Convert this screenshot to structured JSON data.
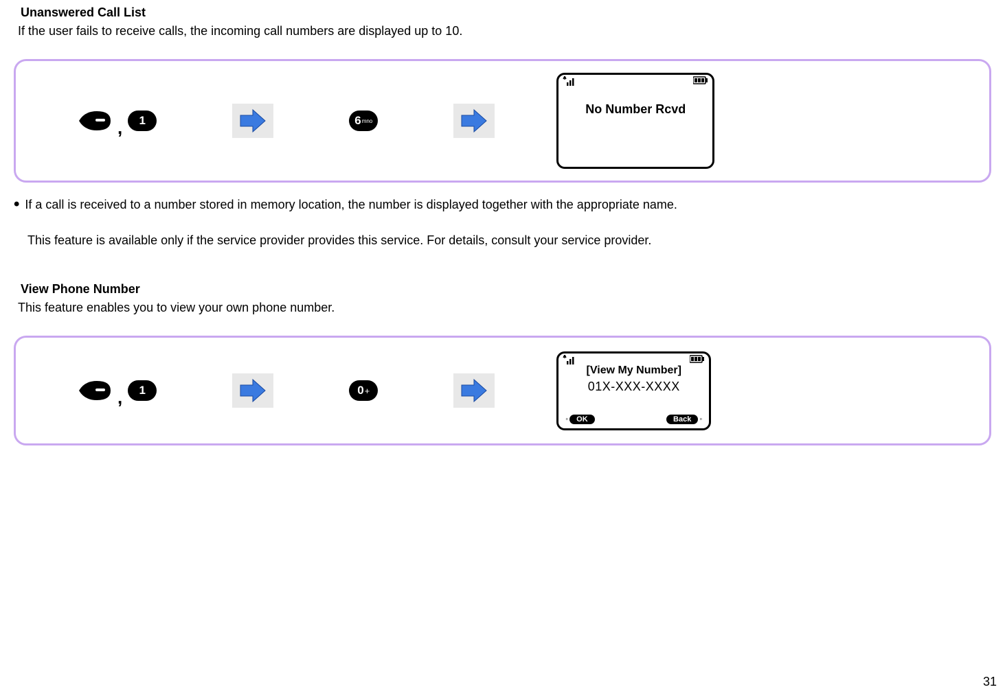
{
  "section1": {
    "heading": "Unanswered Call List",
    "description": "If the user fails to receive calls, the incoming call numbers are displayed up to 10."
  },
  "diagram1": {
    "key1": "1",
    "key2": "6",
    "key2_sub": "mno",
    "screen_text": "No Number Rcvd"
  },
  "bullet1": "If a call is received to a number stored in memory location, the number is displayed together with the appropriate name.",
  "note1": "This feature is available only if the service provider provides this service. For details, consult your service provider.",
  "section2": {
    "heading": "View Phone Number",
    "description": "This feature enables you to view your own phone number."
  },
  "diagram2": {
    "key1": "1",
    "key2": "0",
    "key2_sub": "+",
    "screen_title": "[View My Number]",
    "screen_number": "01X-XXX-XXXX",
    "softkey_left": "OK",
    "softkey_right": "Back"
  },
  "page_number": "31"
}
